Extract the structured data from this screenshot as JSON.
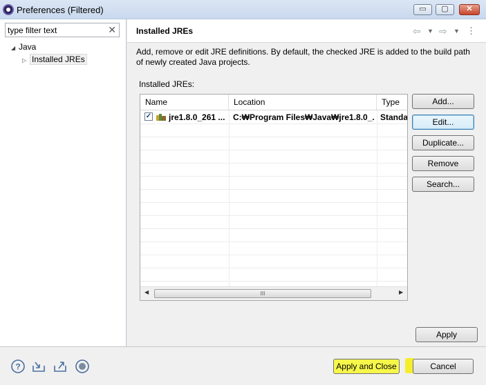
{
  "window": {
    "title": "Preferences (Filtered)",
    "min_label": "▭",
    "max_label": "▢",
    "close_label": "✕"
  },
  "sidebar": {
    "filter_placeholder": "type filter text",
    "filter_value": "type filter text",
    "clear_label": "✕",
    "tree": [
      {
        "label": "Java",
        "twisty": "◢"
      },
      {
        "label": "Installed JREs",
        "twisty": "▷"
      }
    ]
  },
  "page": {
    "title": "Installed JREs",
    "description": "Add, remove or edit JRE definitions. By default, the checked JRE is added to the build path of newly created Java projects.",
    "list_label": "Installed JREs:",
    "nav": {
      "back": "⇦",
      "forward": "⇨",
      "dropdown": "▼",
      "menu": "⋮"
    }
  },
  "table": {
    "columns": [
      "Name",
      "Location",
      "Type"
    ],
    "rows": [
      {
        "checked": true,
        "name": "jre1.8.0_261 ...",
        "location": "C:₩Program Files₩Java₩jre1.8.0_...",
        "type": "Standa"
      }
    ],
    "scroll": {
      "left": "◀",
      "right": "▶",
      "grip": "III"
    }
  },
  "buttons": {
    "add": "Add...",
    "edit": "Edit...",
    "duplicate": "Duplicate...",
    "remove": "Remove",
    "search": "Search...",
    "apply": "Apply"
  },
  "footer": {
    "apply_close": "Apply and Close",
    "cancel": "Cancel",
    "icons": [
      "help-icon",
      "import-icon",
      "export-icon",
      "record-icon"
    ]
  },
  "colors": {
    "highlight": "#f5ee2a",
    "accent": "#3c7fb1"
  }
}
